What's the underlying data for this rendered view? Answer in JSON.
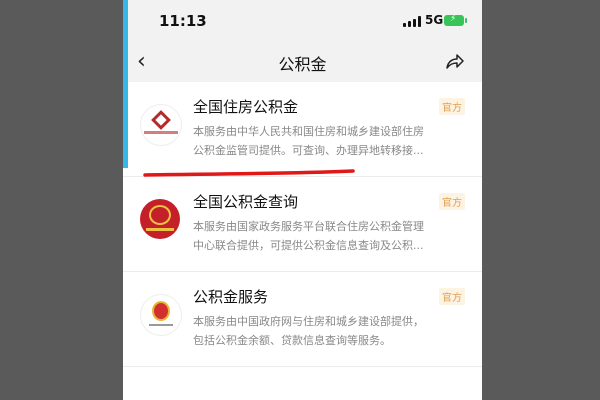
{
  "status": {
    "time": "11:13",
    "network": "5G"
  },
  "nav": {
    "title": "公积金"
  },
  "results": [
    {
      "title": "全国住房公积金",
      "badge": "官方",
      "desc_line1": "本服务由中华人民共和国住房和城乡建设部住房",
      "desc_line2": "公积金监管司提供。可查询、办理异地转移接...",
      "logo_icon": "housing-fund-logo"
    },
    {
      "title": "全国公积金查询",
      "badge": "官方",
      "desc_line1": "本服务由国家政务服务平台联合住房公积金管理",
      "desc_line2": "中心联合提供，可提供公积金信息查询及公积...",
      "logo_icon": "national-gov-service-logo"
    },
    {
      "title": "公积金服务",
      "badge": "官方",
      "desc_line1": "本服务由中国政府网与住房和城乡建设部提供，",
      "desc_line2": "包括公积金余额、贷款信息查询等服务。",
      "logo_icon": "national-emblem-logo"
    }
  ],
  "colors": {
    "accent": "#35b8e8",
    "annotation": "#e01818",
    "badge": "#e0a050"
  }
}
